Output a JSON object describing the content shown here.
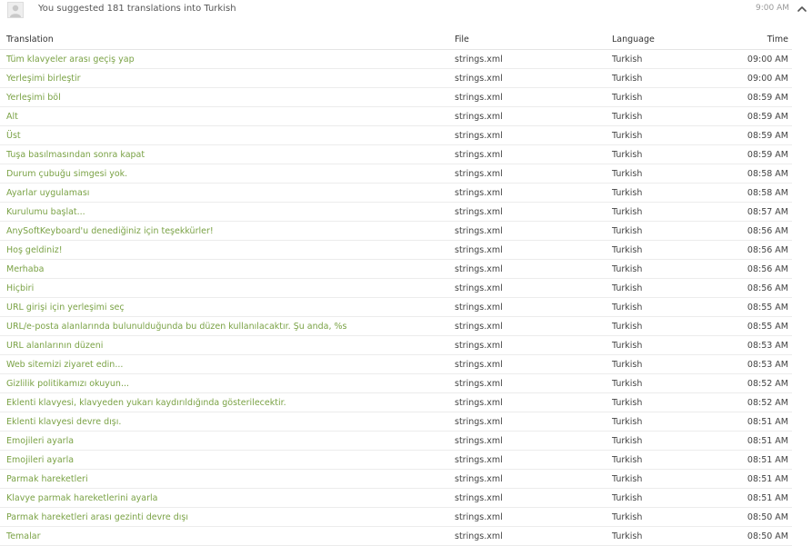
{
  "header": {
    "message": "You suggested 181 translations into Turkish",
    "time": "9:00 AM",
    "avatar_icon": "user-avatar-icon",
    "collapse_icon": "chevron-up-icon"
  },
  "table": {
    "columns": {
      "translation": "Translation",
      "file": "File",
      "language": "Language",
      "time": "Time"
    },
    "rows": [
      {
        "translation": "Tüm klavyeler arası geçiş yap",
        "file": "strings.xml",
        "language": "Turkish",
        "time": "09:00 AM"
      },
      {
        "translation": "Yerleşimi birleştir",
        "file": "strings.xml",
        "language": "Turkish",
        "time": "09:00 AM"
      },
      {
        "translation": "Yerleşimi böl",
        "file": "strings.xml",
        "language": "Turkish",
        "time": "08:59 AM"
      },
      {
        "translation": "Alt",
        "file": "strings.xml",
        "language": "Turkish",
        "time": "08:59 AM"
      },
      {
        "translation": "Üst",
        "file": "strings.xml",
        "language": "Turkish",
        "time": "08:59 AM"
      },
      {
        "translation": "Tuşa basılmasından sonra kapat",
        "file": "strings.xml",
        "language": "Turkish",
        "time": "08:59 AM"
      },
      {
        "translation": "Durum çubuğu simgesi yok.",
        "file": "strings.xml",
        "language": "Turkish",
        "time": "08:58 AM"
      },
      {
        "translation": "Ayarlar uygulaması",
        "file": "strings.xml",
        "language": "Turkish",
        "time": "08:58 AM"
      },
      {
        "translation": "Kurulumu başlat...",
        "file": "strings.xml",
        "language": "Turkish",
        "time": "08:57 AM"
      },
      {
        "translation": "AnySoftKeyboard'u denediğiniz için teşekkürler!",
        "file": "strings.xml",
        "language": "Turkish",
        "time": "08:56 AM"
      },
      {
        "translation": "Hoş geldiniz!",
        "file": "strings.xml",
        "language": "Turkish",
        "time": "08:56 AM"
      },
      {
        "translation": "Merhaba",
        "file": "strings.xml",
        "language": "Turkish",
        "time": "08:56 AM"
      },
      {
        "translation": "Hiçbiri",
        "file": "strings.xml",
        "language": "Turkish",
        "time": "08:56 AM"
      },
      {
        "translation": "URL girişi için yerleşimi seç",
        "file": "strings.xml",
        "language": "Turkish",
        "time": "08:55 AM"
      },
      {
        "translation": "URL/e-posta alanlarında bulunulduğunda bu düzen kullanılacaktır. Şu anda, %s",
        "file": "strings.xml",
        "language": "Turkish",
        "time": "08:55 AM"
      },
      {
        "translation": "URL alanlarının düzeni",
        "file": "strings.xml",
        "language": "Turkish",
        "time": "08:53 AM"
      },
      {
        "translation": "Web sitemizi ziyaret edin...",
        "file": "strings.xml",
        "language": "Turkish",
        "time": "08:53 AM"
      },
      {
        "translation": "Gizlilik politikamızı okuyun...",
        "file": "strings.xml",
        "language": "Turkish",
        "time": "08:52 AM"
      },
      {
        "translation": "Eklenti klavyesi, klavyeden yukarı kaydırıldığında gösterilecektir.",
        "file": "strings.xml",
        "language": "Turkish",
        "time": "08:52 AM"
      },
      {
        "translation": "Eklenti klavyesi devre dışı.",
        "file": "strings.xml",
        "language": "Turkish",
        "time": "08:51 AM"
      },
      {
        "translation": "Emojileri ayarla",
        "file": "strings.xml",
        "language": "Turkish",
        "time": "08:51 AM"
      },
      {
        "translation": "Emojileri ayarla",
        "file": "strings.xml",
        "language": "Turkish",
        "time": "08:51 AM"
      },
      {
        "translation": "Parmak hareketleri",
        "file": "strings.xml",
        "language": "Turkish",
        "time": "08:51 AM"
      },
      {
        "translation": "Klavye parmak hareketlerini ayarla",
        "file": "strings.xml",
        "language": "Turkish",
        "time": "08:51 AM"
      },
      {
        "translation": "Parmak hareketleri arası gezinti devre dışı",
        "file": "strings.xml",
        "language": "Turkish",
        "time": "08:50 AM"
      },
      {
        "translation": "Temalar",
        "file": "strings.xml",
        "language": "Turkish",
        "time": "08:50 AM"
      }
    ]
  },
  "colors": {
    "link_green": "#7aa245",
    "row_border": "#ececec",
    "muted_text": "#999999"
  }
}
